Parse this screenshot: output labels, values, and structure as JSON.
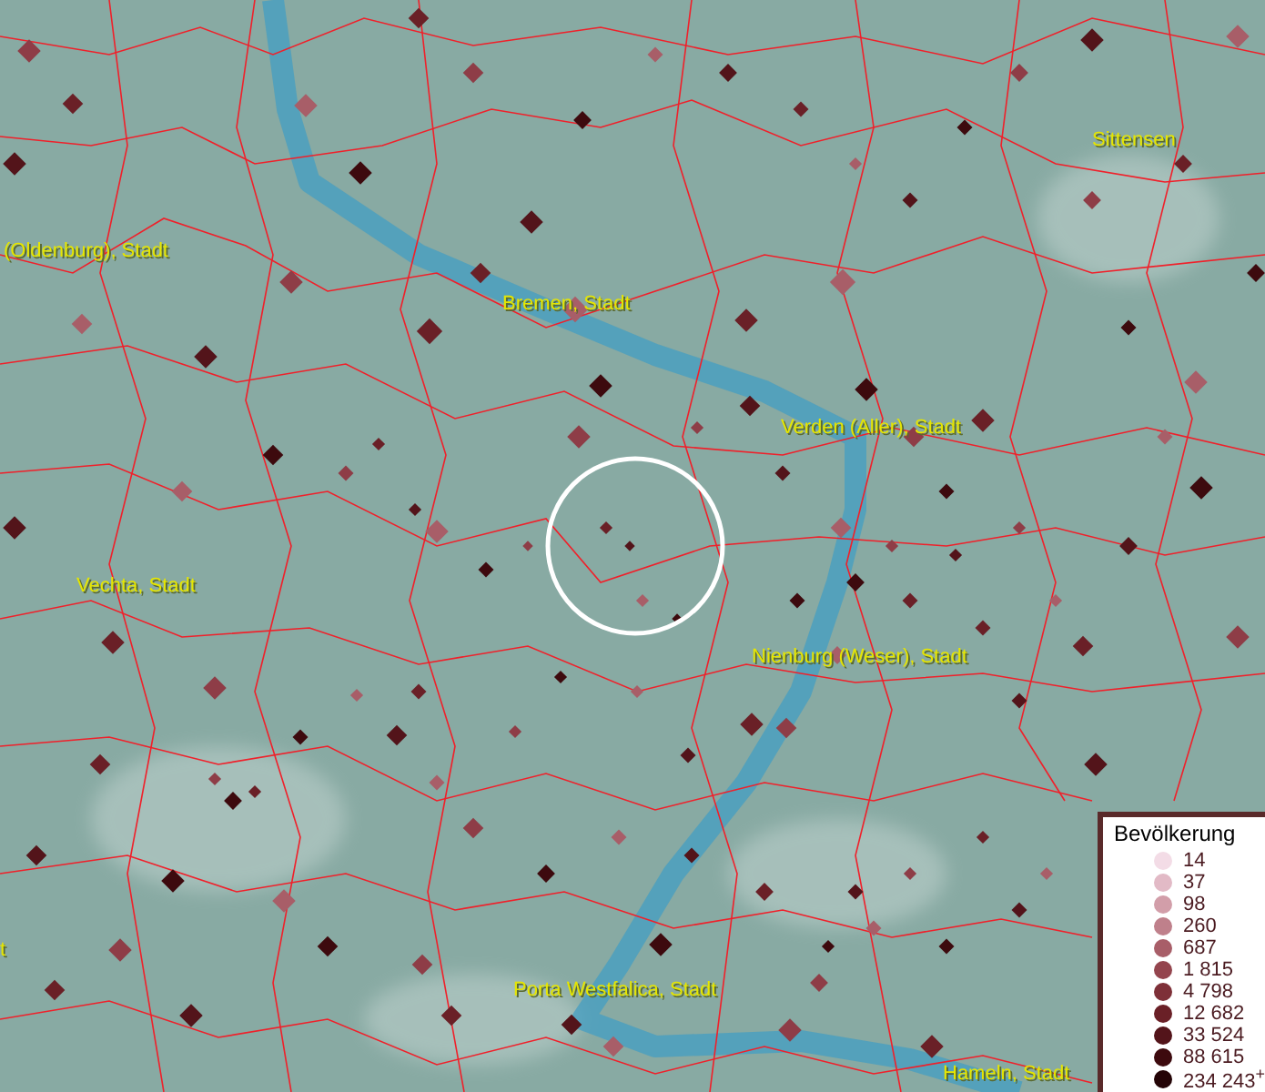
{
  "places": [
    {
      "name": "(Oldenburg), Stadt"
    },
    {
      "name": "Bremen, Stadt"
    },
    {
      "name": "Sittensen"
    },
    {
      "name": "Verden (Aller), Stadt"
    },
    {
      "name": "Vechta, Stadt"
    },
    {
      "name": "Nienburg (Weser), Stadt"
    },
    {
      "name": "Porta Westfalica, Stadt"
    },
    {
      "name": "Hameln, Stadt"
    },
    {
      "name": "t"
    }
  ],
  "legend": {
    "title": "Bevölkerung",
    "items": [
      {
        "label": "14",
        "color": "#f3dce6"
      },
      {
        "label": "37",
        "color": "#e2bac6"
      },
      {
        "label": "98",
        "color": "#d29ea9"
      },
      {
        "label": "260",
        "color": "#bf808b"
      },
      {
        "label": "687",
        "color": "#a85e68"
      },
      {
        "label": "1 815",
        "color": "#94454e"
      },
      {
        "label": "4 798",
        "color": "#7e3038"
      },
      {
        "label": "12 682",
        "color": "#6a2027"
      },
      {
        "label": "33 524",
        "color": "#53141a"
      },
      {
        "label": "88 615",
        "color": "#3d0a0e"
      },
      {
        "label": "234 243$^{+}$",
        "color": "#240406"
      }
    ]
  }
}
